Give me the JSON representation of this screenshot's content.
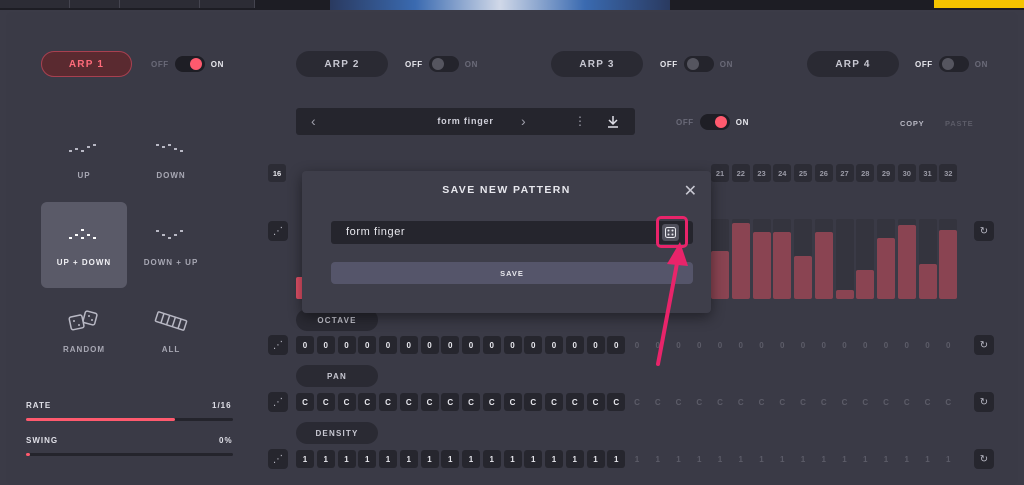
{
  "arps": [
    {
      "label": "ARP 1",
      "off": "OFF",
      "on": "ON",
      "state": "on"
    },
    {
      "label": "ARP 2",
      "off": "OFF",
      "on": "ON",
      "state": "off"
    },
    {
      "label": "ARP 3",
      "off": "OFF",
      "on": "ON",
      "state": "off"
    },
    {
      "label": "ARP 4",
      "off": "OFF",
      "on": "ON",
      "state": "off"
    }
  ],
  "modes": [
    {
      "label": "UP",
      "icon": "arp-up-icon"
    },
    {
      "label": "DOWN",
      "icon": "arp-down-icon"
    },
    {
      "label": "UP + DOWN",
      "icon": "arp-up-down-icon",
      "selected": true
    },
    {
      "label": "DOWN + UP",
      "icon": "arp-down-up-icon"
    },
    {
      "label": "RANDOM",
      "icon": "dice-icon"
    },
    {
      "label": "ALL",
      "icon": "keyboard-icon"
    }
  ],
  "rate": {
    "label": "RATE",
    "value": "1/16",
    "fill": 0.72
  },
  "swing": {
    "label": "SWING",
    "value": "0%",
    "fill": 0.0
  },
  "pattern_browser": {
    "name": "form finger",
    "prev": "‹",
    "next": "›"
  },
  "pattern_toggle": {
    "off": "OFF",
    "on": "ON"
  },
  "copy_label": "COPY",
  "paste_label": "PASTE",
  "steps_count": "16",
  "step_headers_visible": [
    "21",
    "22",
    "23",
    "24",
    "25",
    "26",
    "27",
    "28",
    "29",
    "30",
    "31",
    "32"
  ],
  "velocity_bars_visible": [
    0.62,
    0.97,
    0.86,
    0.86,
    0.55,
    0.86,
    0.12,
    0.37,
    0.78,
    0.95,
    0.45,
    0.88
  ],
  "octave": {
    "label": "OCTAVE",
    "values": [
      "0",
      "0",
      "0",
      "0",
      "0",
      "0",
      "0",
      "0",
      "0",
      "0",
      "0",
      "0",
      "0",
      "0",
      "0",
      "0",
      "0",
      "0",
      "0",
      "0",
      "0",
      "0",
      "0",
      "0",
      "0",
      "0",
      "0",
      "0",
      "0",
      "0",
      "0",
      "0"
    ]
  },
  "pan": {
    "label": "PAN",
    "values": [
      "C",
      "C",
      "C",
      "C",
      "C",
      "C",
      "C",
      "C",
      "C",
      "C",
      "C",
      "C",
      "C",
      "C",
      "C",
      "C",
      "C",
      "C",
      "C",
      "C",
      "C",
      "C",
      "C",
      "C",
      "C",
      "C",
      "C",
      "C",
      "C",
      "C",
      "C",
      "C"
    ]
  },
  "density": {
    "label": "DENSITY",
    "values": [
      "1",
      "1",
      "1",
      "1",
      "1",
      "1",
      "1",
      "1",
      "1",
      "1",
      "1",
      "1",
      "1",
      "1",
      "1",
      "1",
      "1",
      "1",
      "1",
      "1",
      "1",
      "1",
      "1",
      "1",
      "1",
      "1",
      "1",
      "1",
      "1",
      "1",
      "1",
      "1"
    ]
  },
  "active_steps": 16,
  "dialog": {
    "title": "SAVE NEW PATTERN",
    "input_value": "form finger",
    "save_label": "SAVE",
    "close": "✕"
  },
  "colors": {
    "accent": "#ff5a6e",
    "highlight": "#e8246a",
    "bar": "#8a4452"
  }
}
